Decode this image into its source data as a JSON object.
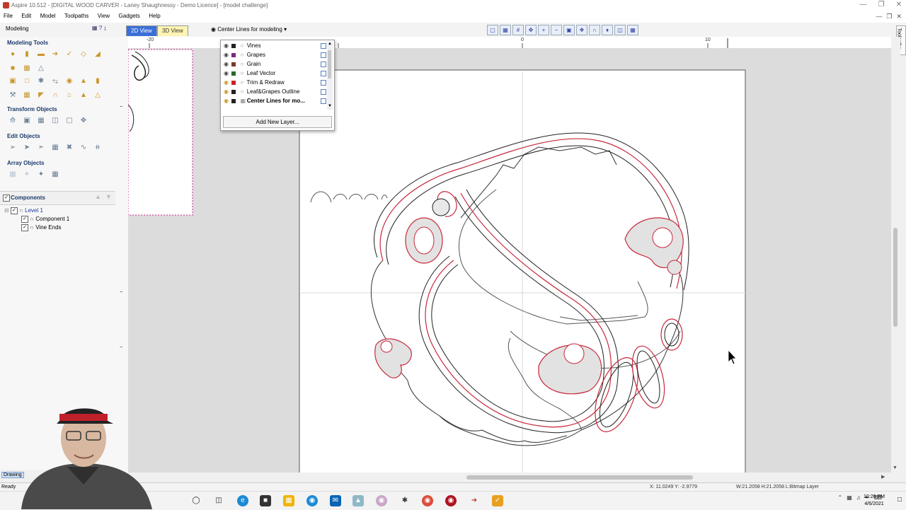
{
  "window": {
    "title": "Aspire 10.512 - [DIGITAL WOOD CARVER - Laney Shaughnessy - Demo Licence] - [model challenge]"
  },
  "menu": {
    "items": [
      "File",
      "Edit",
      "Model",
      "Toolpaths",
      "View",
      "Gadgets",
      "Help"
    ]
  },
  "toolbar": {
    "modeling_tab": "Modeling",
    "tab_2d": "2D View",
    "tab_3d": "3D View",
    "active_layer": "Center Lines for modeling"
  },
  "sidebar": {
    "modeling_tools_title": "Modeling Tools",
    "transform_title": "Transform Objects",
    "edit_title": "Edit Objects",
    "array_title": "Array Objects"
  },
  "components": {
    "title": "Components",
    "tree": [
      {
        "label": "Level 1"
      },
      {
        "label": "Component 1"
      },
      {
        "label": "Vine Ends"
      }
    ]
  },
  "layers": {
    "items": [
      {
        "name": "Vines",
        "color": "#222222"
      },
      {
        "name": "Grapes",
        "color": "#7a2a7a"
      },
      {
        "name": "Grain",
        "color": "#7a3a2a"
      },
      {
        "name": "Leaf Vector",
        "color": "#2a6a2a"
      },
      {
        "name": "Trim & Redraw",
        "color": "#cc2222"
      },
      {
        "name": "Leaf&Grapes Outline",
        "color": "#222222"
      },
      {
        "name": "Center Lines for mo...",
        "color": "#222222"
      }
    ],
    "add_label": "Add New Layer..."
  },
  "ruler": {
    "labels": [
      "-20",
      "0",
      "10"
    ]
  },
  "side_strip": {
    "label": "Toolpaths"
  },
  "status": {
    "left": "Drawing",
    "ready": "Ready",
    "coords": "X: 11.0249 Y: -2.9779",
    "dims": "W:21.2058  H:21.2058  L:Bitmap Layer"
  },
  "clock": {
    "time": "10:26 PM",
    "date": "4/6/2021"
  },
  "colors": {
    "accent_tab": "#3a6fd8",
    "vector_red": "#c8283c",
    "vector_black": "#222222",
    "sheet": "#ffffff",
    "canvas_bg": "#dcdcdc"
  }
}
